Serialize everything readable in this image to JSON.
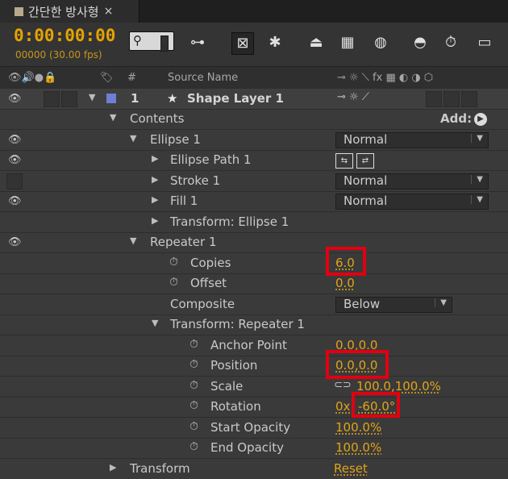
{
  "tab": {
    "title": "간단한 방사형",
    "close": "×"
  },
  "toolbar": {
    "timecode": "0:00:00:00",
    "frame_fps": "00000 (30.00 fps)"
  },
  "columns": {
    "num": "#",
    "source_name": "Source Name"
  },
  "layer": {
    "number": "1",
    "name": "Shape Layer 1"
  },
  "contents": {
    "label": "Contents",
    "add_label": "Add:"
  },
  "ellipse": {
    "label": "Ellipse 1",
    "blend": "Normal",
    "path": "Ellipse Path 1",
    "stroke": "Stroke 1",
    "stroke_blend": "Normal",
    "fill": "Fill 1",
    "fill_blend": "Normal",
    "transform": "Transform: Ellipse 1"
  },
  "repeater": {
    "label": "Repeater 1",
    "copies_label": "Copies",
    "copies_value": "6.0",
    "offset_label": "Offset",
    "offset_value": "0.0",
    "composite_label": "Composite",
    "composite_value": "Below",
    "transform_label": "Transform: Repeater 1",
    "anchor_label": "Anchor Point",
    "anchor_value": "0.0,0.0",
    "position_label": "Position",
    "position_value": "0.0,0.0",
    "scale_label": "Scale",
    "scale_value": "100.0,100.0%",
    "rotation_label": "Rotation",
    "rotation_turns": "0x",
    "rotation_value": "-60.0°",
    "start_opacity_label": "Start Opacity",
    "start_opacity_value": "100.0%",
    "end_opacity_label": "End Opacity",
    "end_opacity_value": "100.0%"
  },
  "transform": {
    "label": "Transform",
    "reset": "Reset"
  },
  "colors": {
    "accent_value": "#e2a418",
    "highlight": "#e20010",
    "label_swatch": "#6f7fd6"
  }
}
